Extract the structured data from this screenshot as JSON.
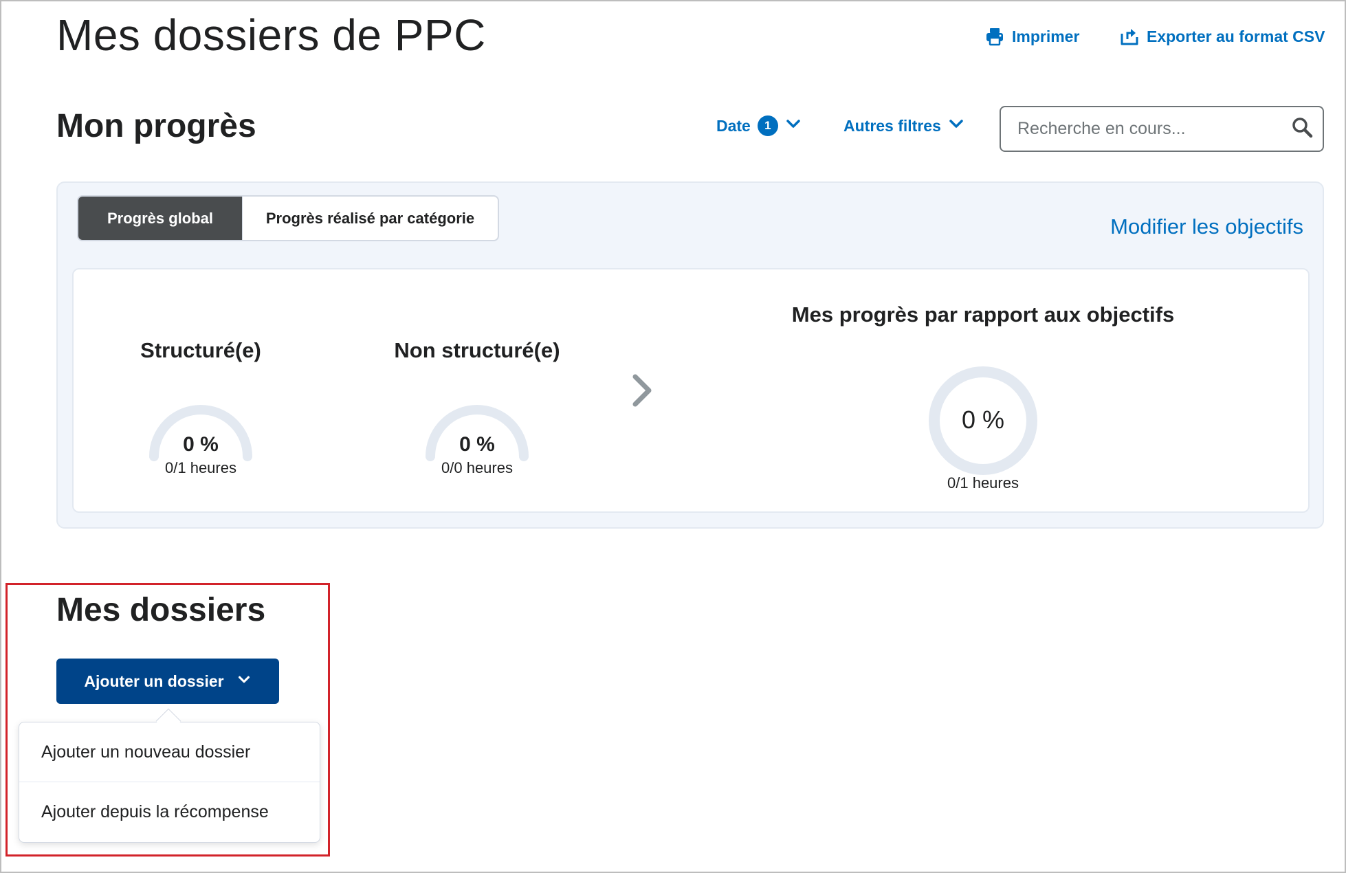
{
  "header": {
    "title": "Mes dossiers de PPC",
    "print_label": "Imprimer",
    "export_label": "Exporter au format CSV",
    "print_icon": "printer-icon",
    "export_icon": "export-icon"
  },
  "progress_section": {
    "title": "Mon progrès",
    "filters": {
      "date_label": "Date",
      "date_count": "1",
      "other_label": "Autres filtres"
    },
    "search": {
      "placeholder": "Recherche en cours..."
    },
    "tabs": [
      {
        "label": "Progrès global",
        "selected": true
      },
      {
        "label": "Progrès réalisé par catégorie",
        "selected": false
      }
    ],
    "edit_goals_label": "Modifier les objectifs",
    "structured": {
      "title": "Structuré(e)",
      "percent_text": "0 %",
      "percent_value": 0,
      "hours_text": "0/1 heures"
    },
    "unstructured": {
      "title": "Non structuré(e)",
      "percent_text": "0 %",
      "percent_value": 0,
      "hours_text": "0/0 heures"
    },
    "goals": {
      "title": "Mes progrès par rapport aux objectifs",
      "percent_text": "0 %",
      "percent_value": 0,
      "hours_text": "0/1 heures"
    }
  },
  "folders_section": {
    "title": "Mes dossiers",
    "add_button_label": "Ajouter un dossier",
    "menu_items": [
      {
        "label": "Ajouter un nouveau dossier"
      },
      {
        "label": "Ajouter depuis la récompense"
      }
    ]
  },
  "colors": {
    "accent": "#006fbf",
    "primary_button": "#004489",
    "active_tab": "#494c4e",
    "gauge_track": "#e3e9f1",
    "highlight_border": "#d2232a"
  }
}
